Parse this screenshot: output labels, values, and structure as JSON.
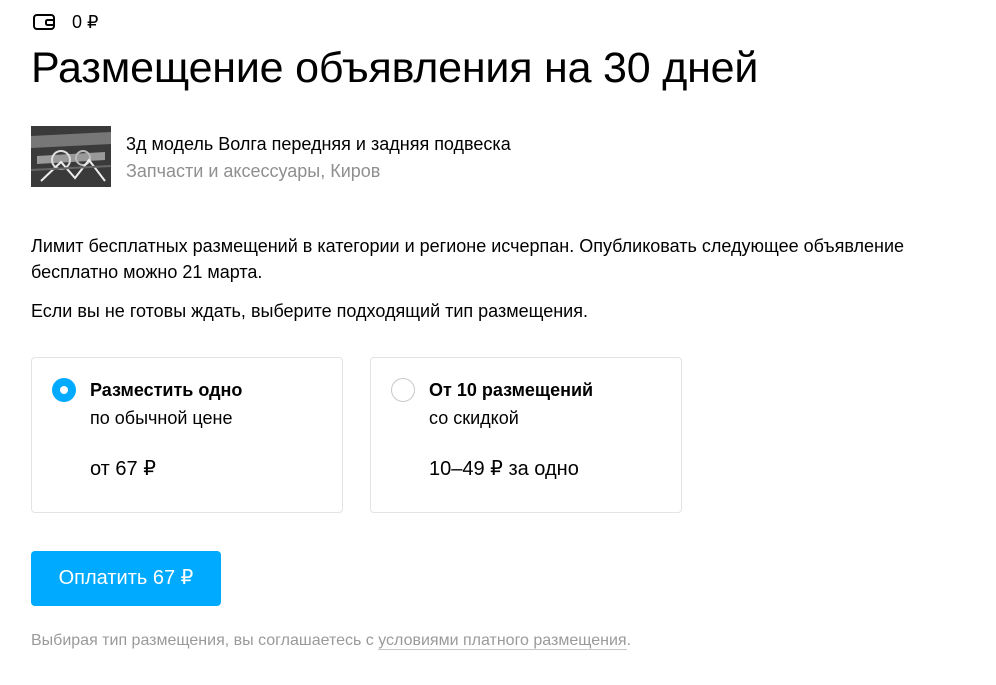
{
  "wallet": {
    "icon": "wallet-icon",
    "balance": "0 ₽"
  },
  "page_title": "Размещение объявления на 30 дней",
  "item": {
    "thumbnail_icon": "item-thumbnail",
    "title": "3д модель Волга передняя и задняя подвеска",
    "meta": "Запчасти и аксессуары, Киров"
  },
  "notice": {
    "limit_text": "Лимит бесплатных размещений в категории и регионе исчерпан. Опубликовать следующее объявление бесплатно можно 21 марта.",
    "hint_text": "Если вы не готовы ждать, выберите подходящий тип размещения."
  },
  "options": [
    {
      "title": "Разместить одно",
      "subtitle": "по обычной цене",
      "price": "от 67 ₽",
      "selected": true
    },
    {
      "title": "От 10 размещений",
      "subtitle": "со скидкой",
      "price": "10–49 ₽ за одно",
      "selected": false
    }
  ],
  "pay_button": {
    "label": "Оплатить 67 ₽"
  },
  "footer": {
    "text_before": "Выбирая тип размещения, вы соглашаетесь с ",
    "link_text": "условиями платного размещения",
    "text_after": "."
  },
  "colors": {
    "accent": "#00aaff",
    "muted_text": "#8f8f8f",
    "border": "#e3e3e3"
  }
}
